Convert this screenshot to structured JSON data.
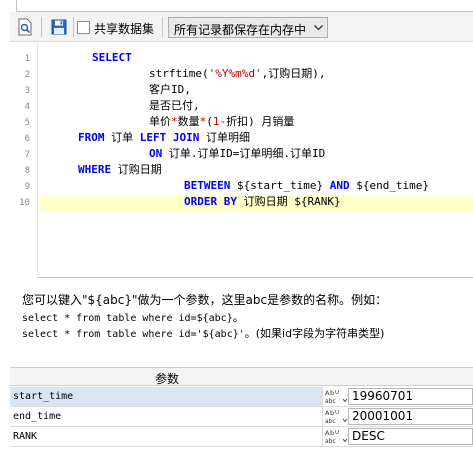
{
  "toolbar": {
    "share_label": "共享数据集",
    "mode_value": "所有记录都保存在内存中"
  },
  "editor": {
    "line_numbers": [
      "1",
      "2",
      "3",
      "4",
      "5",
      "6",
      "7",
      "8",
      "9",
      "10"
    ],
    "lines": {
      "l1": {
        "kw": "SELECT"
      },
      "l2": {
        "fn": "strftime(",
        "str": "'%Y%m%d'",
        "rest": ",订购日期),"
      },
      "l3": {
        "text": "客户ID,"
      },
      "l4": {
        "text": "是否已付,"
      },
      "l5": {
        "a": "单价",
        "op1": "*",
        "b": "数量",
        "op2": "*",
        "c": "(",
        "num": "1",
        "op3": "-",
        "d": "折扣) 月销量"
      },
      "l6": {
        "kw1": "FROM",
        "t1": " 订单 ",
        "kw2": "LEFT JOIN",
        "t2": " 订单明细"
      },
      "l7": {
        "kw": "ON",
        "t": " 订单.订单ID=订单明细.订单ID"
      },
      "l8": {
        "kw": "WHERE",
        "t": " 订购日期"
      },
      "l9": {
        "kw1": "BETWEEN",
        "t1": " ${start_time} ",
        "kw2": "AND",
        "t2": " ${end_time}"
      },
      "l10": {
        "kw": "ORDER BY",
        "t": " 订购日期 ${RANK}"
      }
    }
  },
  "help": {
    "intro": "您可以键入\"${abc}\"做为一个参数，这里abc是参数的名称。例如：",
    "ex1_code": "select * from table where id=${abc}",
    "ex1_tail": "。",
    "ex2_code": "select * from table where id='${abc}'",
    "ex2_tail": "。(如果id字段为字符串类型)"
  },
  "params": {
    "header": "参数",
    "type_icon": "abc-type-icon",
    "rows": [
      {
        "name": "start_time",
        "value": "19960701"
      },
      {
        "name": "end_time",
        "value": "20001001"
      },
      {
        "name": "RANK",
        "value": "DESC"
      }
    ]
  },
  "colors": {
    "keyword": "#0000ff",
    "string": "#c00000",
    "current_line": "#ffffc8",
    "selected_row": "#d9e5f1"
  }
}
